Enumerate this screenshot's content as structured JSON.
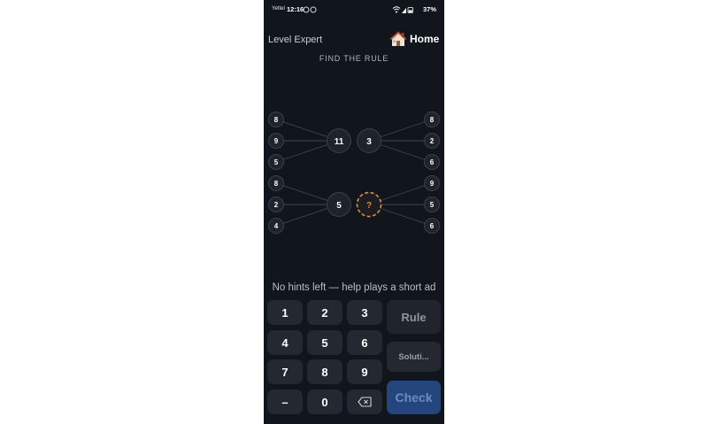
{
  "status_bar": {
    "carrier": "Yettel",
    "time": "12:16",
    "battery": "37%"
  },
  "header": {
    "level": "Level Expert",
    "home_label": "Home",
    "subtitle": "FIND THE RULE"
  },
  "puzzle": {
    "top_left": {
      "inputs": [
        "8",
        "9",
        "5"
      ],
      "result": "11"
    },
    "top_right": {
      "inputs": [
        "8",
        "2",
        "6"
      ],
      "result": "3"
    },
    "bottom_left": {
      "inputs": [
        "8",
        "2",
        "4"
      ],
      "result": "5"
    },
    "bottom_right": {
      "inputs": [
        "9",
        "5",
        "6"
      ],
      "result": "?"
    }
  },
  "hint_text": "No hints left — help plays a short ad",
  "keypad": {
    "keys": [
      "1",
      "2",
      "3",
      "4",
      "5",
      "6",
      "7",
      "8",
      "9",
      "–",
      "0"
    ],
    "rule_label": "Rule",
    "solution_label": "Soluti...",
    "check_label": "Check"
  },
  "colors": {
    "background": "#11151c",
    "node_fill": "#1f242c",
    "unknown_accent": "#e0902a",
    "check_button": "#23467f"
  },
  "icons": [
    "house-icon",
    "wifi-icon",
    "signal-icon",
    "battery-icon",
    "backspace-icon"
  ]
}
